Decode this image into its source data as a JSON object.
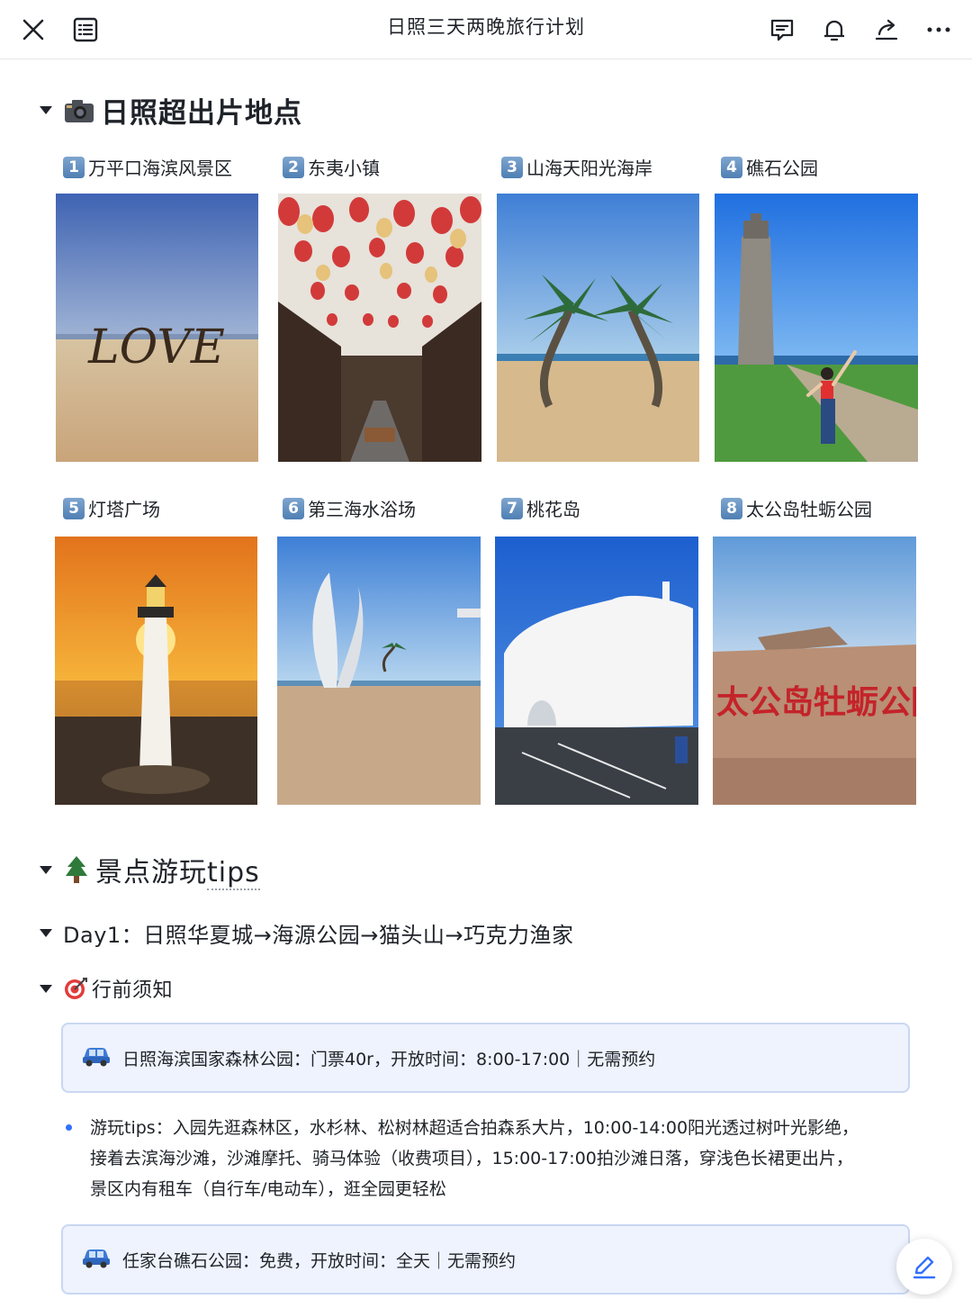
{
  "header": {
    "title": "日照三天两晚旅行计划",
    "icons": [
      "close-icon",
      "outline-icon",
      "comment-icon",
      "bell-icon",
      "share-icon",
      "more-icon"
    ]
  },
  "section1": {
    "emoji": "camera-icon",
    "title": "日照超出片地点"
  },
  "spots": [
    {
      "num": "1",
      "name": "万平口海滨风景区"
    },
    {
      "num": "2",
      "name": "东夷小镇"
    },
    {
      "num": "3",
      "name": "山海天阳光海岸"
    },
    {
      "num": "4",
      "name": "礁石公园"
    },
    {
      "num": "5",
      "name": "灯塔广场"
    },
    {
      "num": "6",
      "name": "第三海水浴场"
    },
    {
      "num": "7",
      "name": "桃花岛"
    },
    {
      "num": "8",
      "name": "太公岛牡蛎公园"
    }
  ],
  "photo_text": {
    "love": "LOVE",
    "rock": "太公岛牡蛎公园"
  },
  "section2": {
    "emoji": "tree-icon",
    "title_main": "景点游玩",
    "title_tips": "tips"
  },
  "day1": {
    "title": "Day1：日照华夏城→海源公园→猫头山→巧克力渔家"
  },
  "notice": {
    "emoji": "target-icon",
    "title": "行前须知"
  },
  "callout1": {
    "text": "日照海滨国家森林公园：门票40r，开放时间：8:00-17:00｜无需预约"
  },
  "tips": {
    "line1": "游玩tips：入园先逛森林区，水杉林、松树林超适合拍森系大片，10:00-14:00阳光透过树叶光影绝，",
    "line2": "接着去滨海沙滩，沙滩摩托、骑马体验（收费项目），15:00-17:00拍沙滩日落，穿浅色长裙更出片，",
    "line3": "景区内有租车（自行车/电动车），逛全园更轻松"
  },
  "callout2": {
    "text": "任家台礁石公园：免费，开放时间：全天｜无需预约"
  },
  "colors": {
    "accent": "#3370ff",
    "callout_bg": "#eef3fd",
    "callout_border": "#c9d7f3"
  }
}
